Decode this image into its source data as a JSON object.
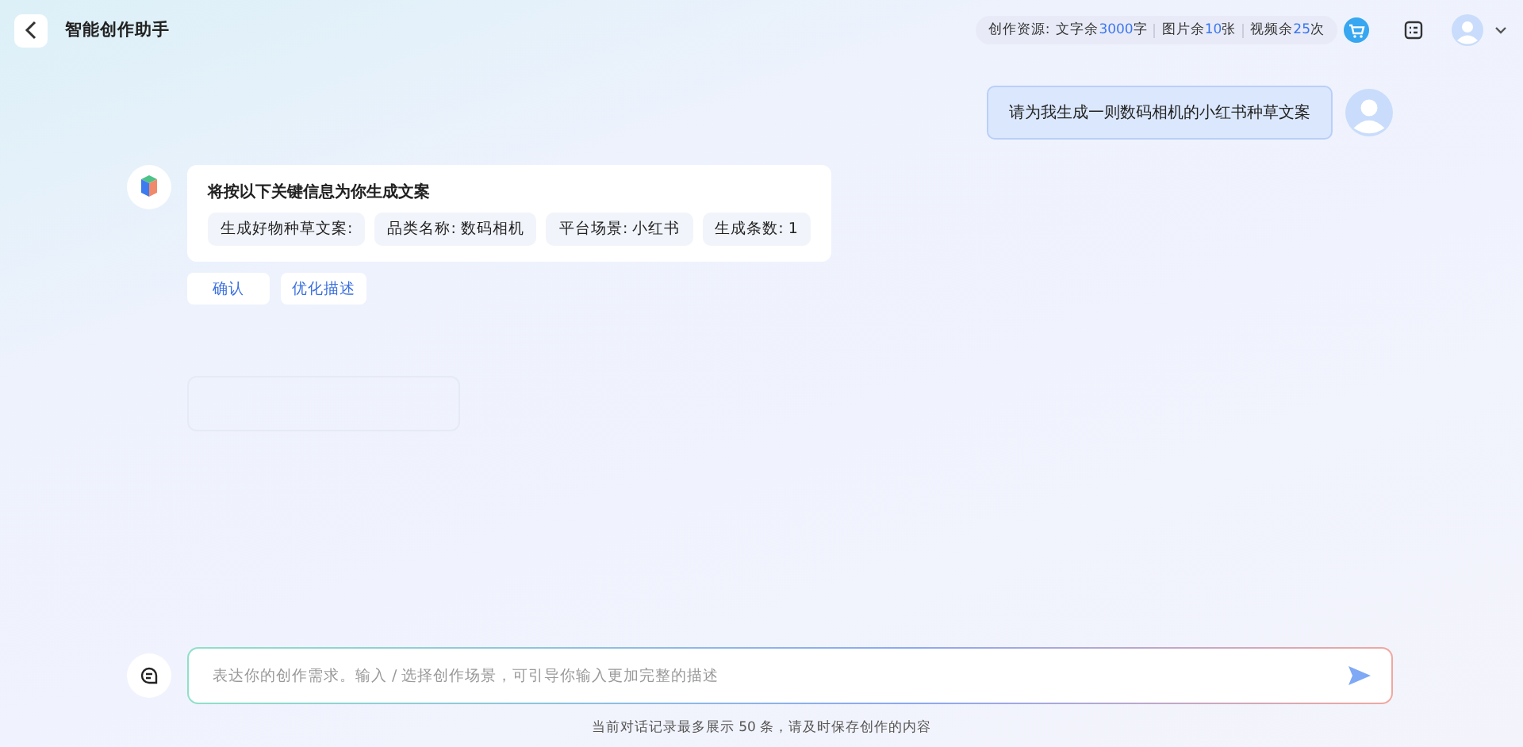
{
  "header": {
    "title": "智能创作助手",
    "resources_label": "创作资源:",
    "resources": [
      {
        "label": "文字余",
        "value": "3000",
        "unit": "字"
      },
      {
        "label": "图片余",
        "value": "10",
        "unit": "张"
      },
      {
        "label": "视频余",
        "value": "25",
        "unit": "次"
      }
    ]
  },
  "messages": [
    {
      "kind": "user",
      "text": "请为我生成一则数码相机的小红书种草文案"
    },
    {
      "kind": "bot",
      "title": "将按以下关键信息为你生成文案",
      "tags": [
        "生成好物种草文案:",
        "品类名称: 数码相机",
        "平台场景: 小红书",
        "生成条数: 1"
      ],
      "actions": [
        "确认",
        "优化描述"
      ]
    },
    {
      "kind": "loading"
    }
  ],
  "input": {
    "placeholder": "表达你的创作需求。输入 / 选择创作场景，可引导你输入更加完整的描述"
  },
  "footer_note": "当前对话记录最多展示 50 条，请及时保存创作的内容"
}
